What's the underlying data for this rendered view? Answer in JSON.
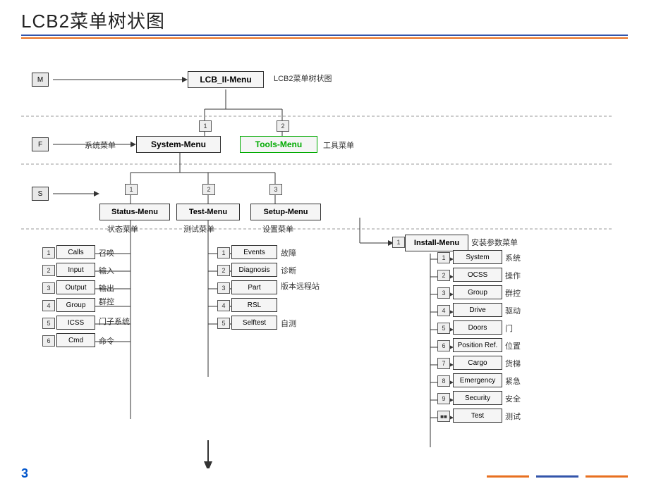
{
  "title": "LCB2菜单树状图",
  "diagram": {
    "top_label": "LCB2菜单树状图",
    "root": "LCB_II-Menu",
    "level1": {
      "left": {
        "name": "System-Menu",
        "label": "系统菜单",
        "key": "F"
      },
      "right": {
        "name": "Tools-Menu",
        "label": "工具菜单",
        "key": ""
      }
    },
    "level2": {
      "items": [
        {
          "name": "Status-Menu",
          "label": "状态菜单",
          "num": "1"
        },
        {
          "name": "Test-Menu",
          "label": "测试菜单",
          "num": "2"
        },
        {
          "name": "Setup-Menu",
          "label": "设置菜单",
          "num": "3"
        }
      ]
    },
    "status_items": [
      {
        "num": "1",
        "name": "Calls",
        "cn": "召唤"
      },
      {
        "num": "2",
        "name": "Input",
        "cn": "输入"
      },
      {
        "num": "3",
        "name": "Output",
        "cn": "输出"
      },
      {
        "num": "4",
        "name": "Group",
        "cn": "群控"
      },
      {
        "num": "5",
        "name": "ICSS",
        "cn": "门子系统"
      },
      {
        "num": "6",
        "name": "Cmd",
        "cn": "命令"
      }
    ],
    "test_items": [
      {
        "num": "1",
        "name": "Events",
        "cn": "故障"
      },
      {
        "num": "2",
        "name": "Diagnosis",
        "cn": "诊断"
      },
      {
        "num": "3",
        "name": "Part",
        "cn": "版本远程站"
      },
      {
        "num": "4",
        "name": "RSL",
        "cn": ""
      },
      {
        "num": "5",
        "name": "Selftest",
        "cn": "自测"
      }
    ],
    "setup_submenu": "Install-Menu",
    "setup_label": "安装参数菜单",
    "setup_items": [
      {
        "num": "1",
        "name": "System",
        "cn": "系统"
      },
      {
        "num": "2",
        "name": "OCSS",
        "cn": "操作"
      },
      {
        "num": "3",
        "name": "Group",
        "cn": "群控"
      },
      {
        "num": "4",
        "name": "Drive",
        "cn": "驱动"
      },
      {
        "num": "5",
        "name": "Doors",
        "cn": "门"
      },
      {
        "num": "6",
        "name": "Position Ref.",
        "cn": "位置"
      },
      {
        "num": "7",
        "name": "Cargo",
        "cn": "货梯"
      },
      {
        "num": "8",
        "name": "Emergency",
        "cn": "紧急"
      },
      {
        "num": "9",
        "name": "Security",
        "cn": "安全"
      },
      {
        "num": "10",
        "name": "Test",
        "cn": "测试"
      }
    ]
  },
  "footer": {
    "page_number": "3"
  }
}
